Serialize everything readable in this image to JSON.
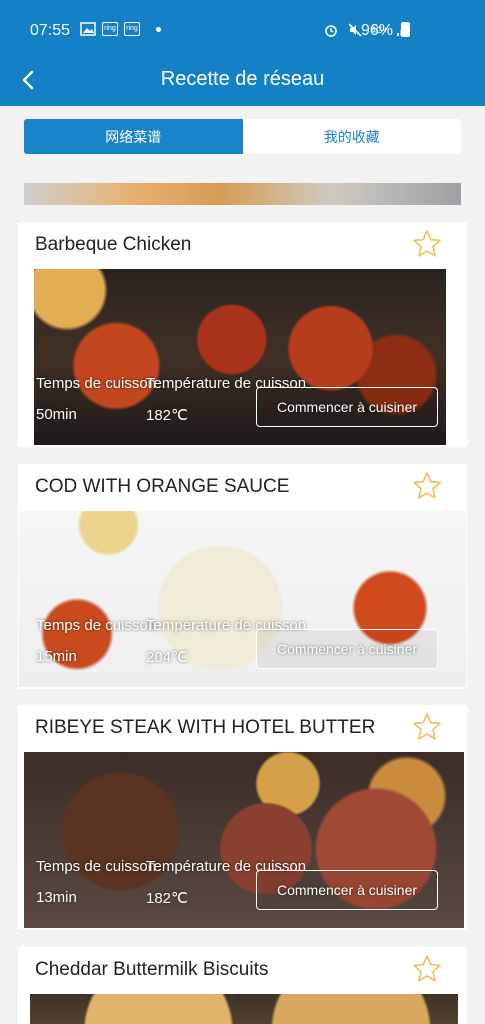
{
  "status_bar": {
    "time": "07:55",
    "left_icons": [
      "image-icon",
      "ring-icon",
      "ring-icon"
    ],
    "ring_label": "ring",
    "network": "4G+",
    "battery": "96%"
  },
  "app_bar": {
    "title": "Recette de réseau",
    "back_icon": "chevron-left-icon"
  },
  "tabs": [
    {
      "label": "网络菜谱",
      "active": true
    },
    {
      "label": "我的收藏",
      "active": false
    }
  ],
  "labels": {
    "time": "Temps de cuisson",
    "temperature": "Température de cuisson",
    "start": "Commencer à cuisiner"
  },
  "recipes": [
    {
      "title": "Barbeque Chicken",
      "time": "50min",
      "temperature": "182℃"
    },
    {
      "title": "COD WITH ORANGE SAUCE",
      "time": "15min",
      "temperature": "204℃"
    },
    {
      "title": "RIBEYE STEAK WITH HOTEL BUTTER",
      "time": "13min",
      "temperature": "182℃"
    },
    {
      "title": "Cheddar Buttermilk Biscuits"
    }
  ],
  "colors": {
    "primary": "#1481c6",
    "star": "#f0c46a"
  }
}
